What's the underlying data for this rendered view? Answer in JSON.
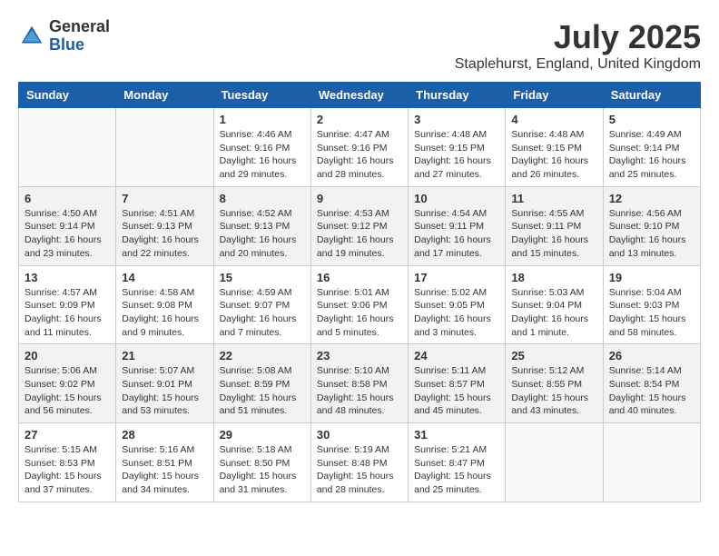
{
  "logo": {
    "general": "General",
    "blue": "Blue"
  },
  "title": {
    "month_year": "July 2025",
    "location": "Staplehurst, England, United Kingdom"
  },
  "days_of_week": [
    "Sunday",
    "Monday",
    "Tuesday",
    "Wednesday",
    "Thursday",
    "Friday",
    "Saturday"
  ],
  "weeks": [
    [
      {
        "day": "",
        "sunrise": "",
        "sunset": "",
        "daylight": ""
      },
      {
        "day": "",
        "sunrise": "",
        "sunset": "",
        "daylight": ""
      },
      {
        "day": "1",
        "sunrise": "Sunrise: 4:46 AM",
        "sunset": "Sunset: 9:16 PM",
        "daylight": "Daylight: 16 hours and 29 minutes."
      },
      {
        "day": "2",
        "sunrise": "Sunrise: 4:47 AM",
        "sunset": "Sunset: 9:16 PM",
        "daylight": "Daylight: 16 hours and 28 minutes."
      },
      {
        "day": "3",
        "sunrise": "Sunrise: 4:48 AM",
        "sunset": "Sunset: 9:15 PM",
        "daylight": "Daylight: 16 hours and 27 minutes."
      },
      {
        "day": "4",
        "sunrise": "Sunrise: 4:48 AM",
        "sunset": "Sunset: 9:15 PM",
        "daylight": "Daylight: 16 hours and 26 minutes."
      },
      {
        "day": "5",
        "sunrise": "Sunrise: 4:49 AM",
        "sunset": "Sunset: 9:14 PM",
        "daylight": "Daylight: 16 hours and 25 minutes."
      }
    ],
    [
      {
        "day": "6",
        "sunrise": "Sunrise: 4:50 AM",
        "sunset": "Sunset: 9:14 PM",
        "daylight": "Daylight: 16 hours and 23 minutes."
      },
      {
        "day": "7",
        "sunrise": "Sunrise: 4:51 AM",
        "sunset": "Sunset: 9:13 PM",
        "daylight": "Daylight: 16 hours and 22 minutes."
      },
      {
        "day": "8",
        "sunrise": "Sunrise: 4:52 AM",
        "sunset": "Sunset: 9:13 PM",
        "daylight": "Daylight: 16 hours and 20 minutes."
      },
      {
        "day": "9",
        "sunrise": "Sunrise: 4:53 AM",
        "sunset": "Sunset: 9:12 PM",
        "daylight": "Daylight: 16 hours and 19 minutes."
      },
      {
        "day": "10",
        "sunrise": "Sunrise: 4:54 AM",
        "sunset": "Sunset: 9:11 PM",
        "daylight": "Daylight: 16 hours and 17 minutes."
      },
      {
        "day": "11",
        "sunrise": "Sunrise: 4:55 AM",
        "sunset": "Sunset: 9:11 PM",
        "daylight": "Daylight: 16 hours and 15 minutes."
      },
      {
        "day": "12",
        "sunrise": "Sunrise: 4:56 AM",
        "sunset": "Sunset: 9:10 PM",
        "daylight": "Daylight: 16 hours and 13 minutes."
      }
    ],
    [
      {
        "day": "13",
        "sunrise": "Sunrise: 4:57 AM",
        "sunset": "Sunset: 9:09 PM",
        "daylight": "Daylight: 16 hours and 11 minutes."
      },
      {
        "day": "14",
        "sunrise": "Sunrise: 4:58 AM",
        "sunset": "Sunset: 9:08 PM",
        "daylight": "Daylight: 16 hours and 9 minutes."
      },
      {
        "day": "15",
        "sunrise": "Sunrise: 4:59 AM",
        "sunset": "Sunset: 9:07 PM",
        "daylight": "Daylight: 16 hours and 7 minutes."
      },
      {
        "day": "16",
        "sunrise": "Sunrise: 5:01 AM",
        "sunset": "Sunset: 9:06 PM",
        "daylight": "Daylight: 16 hours and 5 minutes."
      },
      {
        "day": "17",
        "sunrise": "Sunrise: 5:02 AM",
        "sunset": "Sunset: 9:05 PM",
        "daylight": "Daylight: 16 hours and 3 minutes."
      },
      {
        "day": "18",
        "sunrise": "Sunrise: 5:03 AM",
        "sunset": "Sunset: 9:04 PM",
        "daylight": "Daylight: 16 hours and 1 minute."
      },
      {
        "day": "19",
        "sunrise": "Sunrise: 5:04 AM",
        "sunset": "Sunset: 9:03 PM",
        "daylight": "Daylight: 15 hours and 58 minutes."
      }
    ],
    [
      {
        "day": "20",
        "sunrise": "Sunrise: 5:06 AM",
        "sunset": "Sunset: 9:02 PM",
        "daylight": "Daylight: 15 hours and 56 minutes."
      },
      {
        "day": "21",
        "sunrise": "Sunrise: 5:07 AM",
        "sunset": "Sunset: 9:01 PM",
        "daylight": "Daylight: 15 hours and 53 minutes."
      },
      {
        "day": "22",
        "sunrise": "Sunrise: 5:08 AM",
        "sunset": "Sunset: 8:59 PM",
        "daylight": "Daylight: 15 hours and 51 minutes."
      },
      {
        "day": "23",
        "sunrise": "Sunrise: 5:10 AM",
        "sunset": "Sunset: 8:58 PM",
        "daylight": "Daylight: 15 hours and 48 minutes."
      },
      {
        "day": "24",
        "sunrise": "Sunrise: 5:11 AM",
        "sunset": "Sunset: 8:57 PM",
        "daylight": "Daylight: 15 hours and 45 minutes."
      },
      {
        "day": "25",
        "sunrise": "Sunrise: 5:12 AM",
        "sunset": "Sunset: 8:55 PM",
        "daylight": "Daylight: 15 hours and 43 minutes."
      },
      {
        "day": "26",
        "sunrise": "Sunrise: 5:14 AM",
        "sunset": "Sunset: 8:54 PM",
        "daylight": "Daylight: 15 hours and 40 minutes."
      }
    ],
    [
      {
        "day": "27",
        "sunrise": "Sunrise: 5:15 AM",
        "sunset": "Sunset: 8:53 PM",
        "daylight": "Daylight: 15 hours and 37 minutes."
      },
      {
        "day": "28",
        "sunrise": "Sunrise: 5:16 AM",
        "sunset": "Sunset: 8:51 PM",
        "daylight": "Daylight: 15 hours and 34 minutes."
      },
      {
        "day": "29",
        "sunrise": "Sunrise: 5:18 AM",
        "sunset": "Sunset: 8:50 PM",
        "daylight": "Daylight: 15 hours and 31 minutes."
      },
      {
        "day": "30",
        "sunrise": "Sunrise: 5:19 AM",
        "sunset": "Sunset: 8:48 PM",
        "daylight": "Daylight: 15 hours and 28 minutes."
      },
      {
        "day": "31",
        "sunrise": "Sunrise: 5:21 AM",
        "sunset": "Sunset: 8:47 PM",
        "daylight": "Daylight: 15 hours and 25 minutes."
      },
      {
        "day": "",
        "sunrise": "",
        "sunset": "",
        "daylight": ""
      },
      {
        "day": "",
        "sunrise": "",
        "sunset": "",
        "daylight": ""
      }
    ]
  ]
}
